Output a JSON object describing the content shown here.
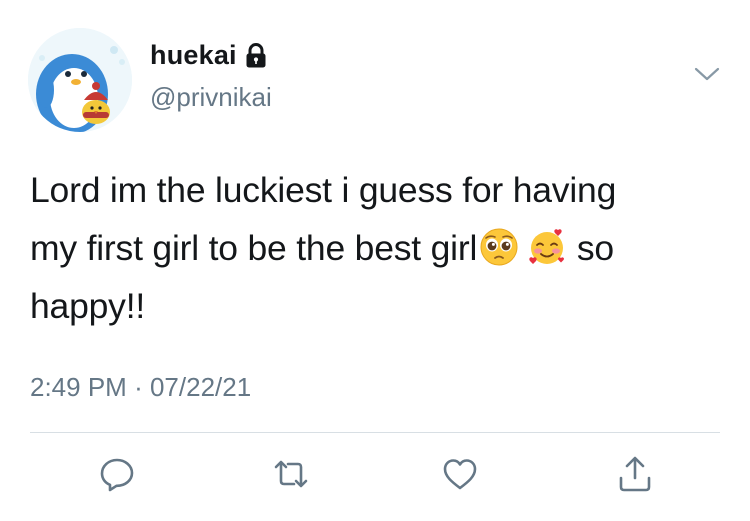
{
  "author": {
    "display_name": "huekai",
    "handle": "@privnikai",
    "protected_icon": "lock-icon",
    "avatar_icon": "penguin-avatar"
  },
  "tweet": {
    "line1": "Lord im the luckiest i guess for having",
    "line2_prefix": "my first girl to be the best girl",
    "emojis": [
      "pleading-face-emoji",
      "smiling-face-with-hearts-emoji"
    ],
    "line2_suffix": "so",
    "line3": "happy!!"
  },
  "timestamp": {
    "time": "2:49 PM",
    "separator": "·",
    "date": "07/22/21"
  },
  "actions": [
    "reply-icon",
    "retweet-icon",
    "like-icon",
    "share-icon"
  ],
  "colors": {
    "text": "#14171a",
    "secondary": "#657786",
    "icon": "#657786",
    "divider": "#d8dfe4"
  }
}
